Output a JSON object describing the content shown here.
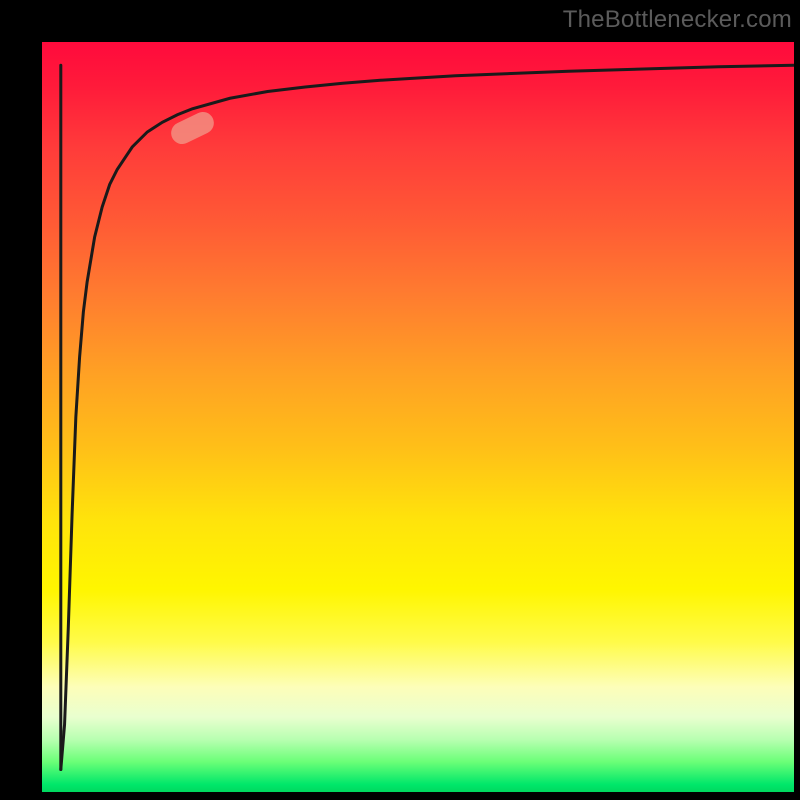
{
  "watermark": "TheBottlenecker.com",
  "colors": {
    "background": "#000000",
    "gradient_top": "#ff0a3c",
    "gradient_bottom": "#00d85f",
    "curve": "#1a1a1a",
    "marker": "#f29b8b"
  },
  "chart_data": {
    "type": "line",
    "title": "",
    "xlabel": "",
    "ylabel": "",
    "xlim": [
      0,
      100
    ],
    "ylim": [
      0,
      100
    ],
    "grid": false,
    "legend": false,
    "annotations": [
      "TheBottlenecker.com"
    ],
    "series": [
      {
        "name": "curve",
        "x": [
          2.5,
          3.0,
          3.5,
          4.0,
          4.5,
          5.0,
          5.5,
          6.0,
          7.0,
          8.0,
          9.0,
          10.0,
          12.0,
          14.0,
          16.0,
          18.0,
          20.0,
          25.0,
          30.0,
          35.0,
          40.0,
          45.0,
          50.0,
          55.0,
          60.0,
          70.0,
          80.0,
          90.0,
          100.0
        ],
        "y": [
          3.0,
          9.0,
          22.0,
          37.0,
          50.0,
          58.0,
          64.0,
          68.0,
          74.0,
          78.0,
          81.0,
          83.0,
          86.0,
          88.0,
          89.3,
          90.3,
          91.1,
          92.5,
          93.4,
          94.0,
          94.5,
          94.9,
          95.2,
          95.5,
          95.7,
          96.1,
          96.4,
          96.7,
          96.9
        ]
      },
      {
        "name": "drop-segment",
        "x": [
          2.5,
          2.5
        ],
        "y": [
          96.9,
          3.0
        ]
      }
    ],
    "marker": {
      "x_percent": 20,
      "y_percent": 88.5,
      "rotation_deg": -26
    }
  }
}
